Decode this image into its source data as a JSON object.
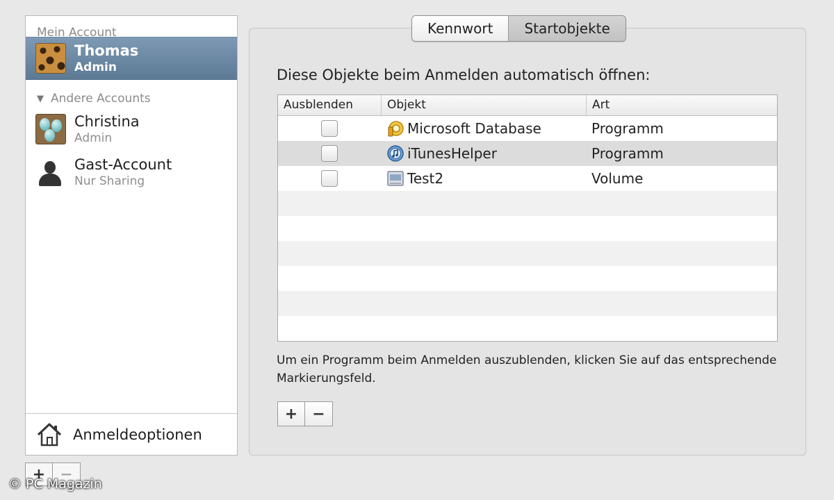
{
  "sidebar": {
    "my_account_header": "Mein Account",
    "other_accounts_header": "Andere Accounts",
    "accounts": [
      {
        "name": "Thomas",
        "role": "Admin",
        "avatar": "leopard-avatar",
        "selected": true
      },
      {
        "name": "Christina",
        "role": "Admin",
        "avatar": "eggs-avatar",
        "selected": false
      },
      {
        "name": "Gast-Account",
        "role": "Nur Sharing",
        "avatar": "silhouette-avatar",
        "selected": false
      }
    ],
    "login_options_label": "Anmeldeoptionen",
    "add_label": "+",
    "remove_label": "−"
  },
  "tabs": [
    {
      "label": "Kennwort",
      "active": false
    },
    {
      "label": "Startobjekte",
      "active": true
    }
  ],
  "main": {
    "heading": "Diese Objekte beim Anmelden automatisch öffnen:",
    "table": {
      "columns": [
        "Ausblenden",
        "Objekt",
        "Art"
      ],
      "rows": [
        {
          "hide": false,
          "icon": "database-icon",
          "object": "Microsoft Database",
          "kind": "Programm"
        },
        {
          "hide": false,
          "icon": "itunes-icon",
          "object": "iTunesHelper",
          "kind": "Programm"
        },
        {
          "hide": false,
          "icon": "volume-icon",
          "object": "Test2",
          "kind": "Volume"
        }
      ]
    },
    "help_text": "Um ein Programm beim Anmelden auszublenden, klicken Sie auf das entsprechende Markierungsfeld.",
    "add_label": "+",
    "remove_label": "−"
  },
  "watermark": "© PC Magazin",
  "colors": {
    "selection": "#6b88a3",
    "panel": "#e4e4e4"
  }
}
